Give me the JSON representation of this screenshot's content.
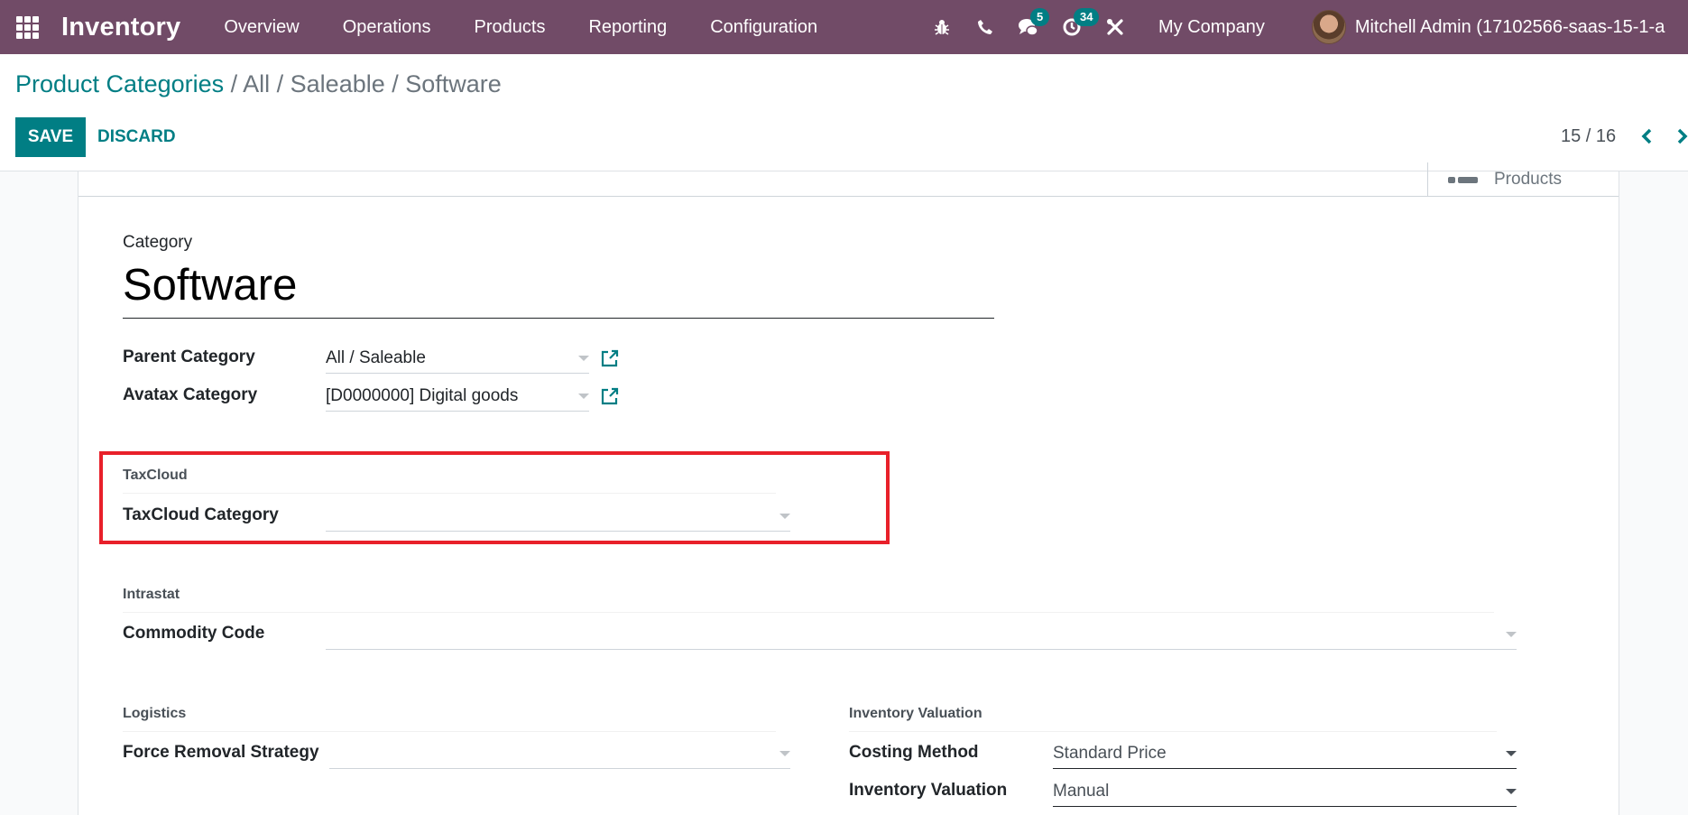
{
  "navbar": {
    "app_name": "Inventory",
    "menu": [
      "Overview",
      "Operations",
      "Products",
      "Reporting",
      "Configuration"
    ],
    "systray": {
      "debug_icon": "bug-icon",
      "phone_icon": "phone-icon",
      "messages_icon": "chat-icon",
      "messages_count": "5",
      "activities_icon": "clock-icon",
      "activities_count": "34",
      "settings_icon": "tools-icon"
    },
    "company": "My Company",
    "user": "Mitchell Admin (17102566-saas-15-1-a"
  },
  "breadcrumb": {
    "root": "Product Categories",
    "separator": " / ",
    "current": "All / Saleable / Software"
  },
  "toolbar": {
    "save_label": "SAVE",
    "discard_label": "DISCARD"
  },
  "pager": {
    "value": "15 / 16",
    "prev_icon": "chevron-left-icon",
    "next_icon": "chevron-right-icon"
  },
  "colors": {
    "navbar": "#714b67",
    "primary": "#017e84",
    "highlight_border": "#e8202a"
  },
  "smart_button": {
    "label": "Products",
    "icon": "list-icon"
  },
  "form": {
    "category_label": "Category",
    "category_name": "Software",
    "parent_category": {
      "label": "Parent Category",
      "value": "All / Saleable"
    },
    "avatax_category": {
      "label": "Avatax Category",
      "value": "[D0000000] Digital goods"
    },
    "taxcloud": {
      "group_title": "TaxCloud",
      "field_label": "TaxCloud Category",
      "value": ""
    },
    "intrastat": {
      "group_title": "Intrastat",
      "field_label": "Commodity Code",
      "value": ""
    },
    "logistics": {
      "group_title": "Logistics",
      "field_label": "Force Removal Strategy",
      "value": ""
    },
    "inventory_valuation": {
      "group_title": "Inventory Valuation",
      "costing_method": {
        "label": "Costing Method",
        "value": "Standard Price"
      },
      "valuation": {
        "label": "Inventory Valuation",
        "value": "Manual"
      }
    }
  }
}
